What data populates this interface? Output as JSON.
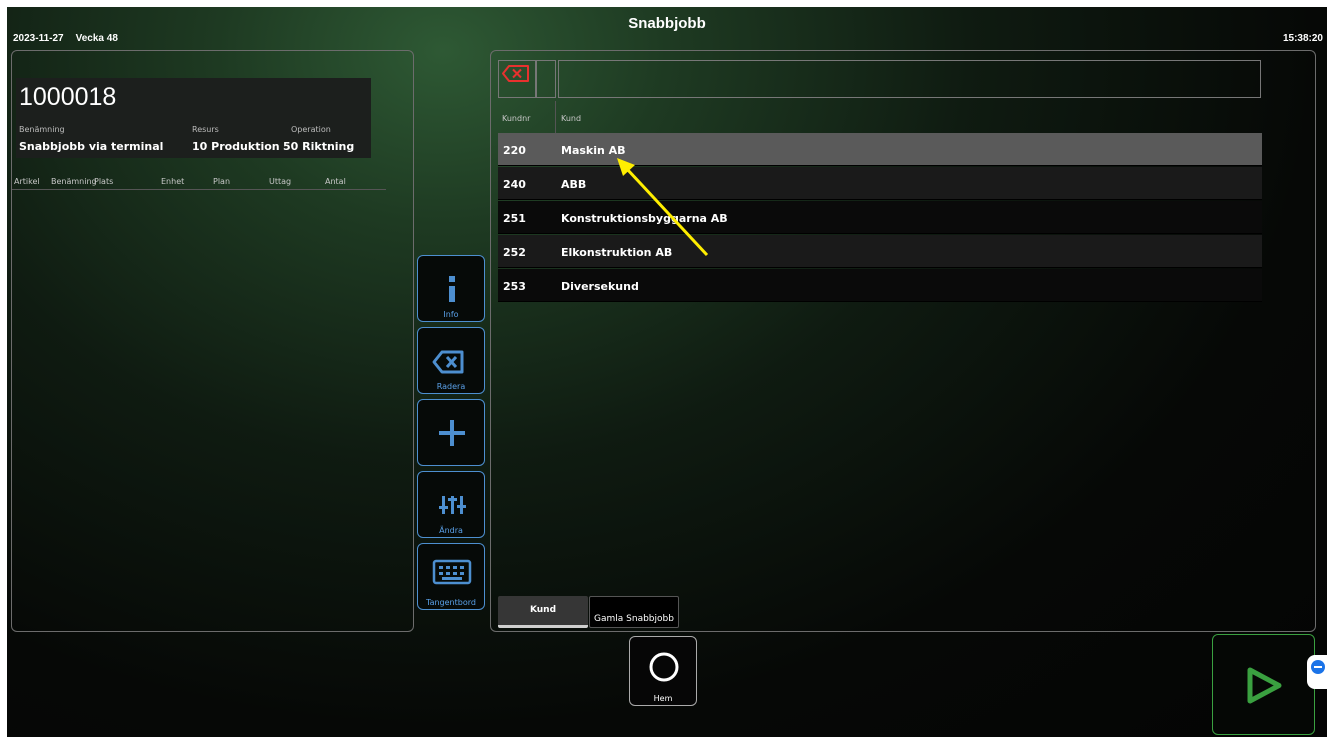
{
  "header": {
    "date": "2023-11-27",
    "week": "Vecka 48",
    "title": "Snabbjobb",
    "clock": "15:38:20"
  },
  "order": {
    "number": "1000018",
    "labels": {
      "benamning": "Benämning",
      "resurs": "Resurs",
      "operation": "Operation"
    },
    "values": {
      "benamning": "Snabbjobb via terminal",
      "resurs": "10 Produktion",
      "operation": "50 Riktning"
    }
  },
  "materials": {
    "columns": [
      "Artikel",
      "Benämning",
      "Plats",
      "Enhet",
      "Plan",
      "Uttag",
      "Antal"
    ]
  },
  "side_buttons": {
    "info": "Info",
    "radera": "Radera",
    "andra": "Ändra",
    "tangentbord": "Tangentbord"
  },
  "search": {
    "value": "",
    "placeholder": ""
  },
  "customer_table": {
    "columns": {
      "nr": "Kundnr",
      "name": "Kund"
    },
    "rows": [
      {
        "nr": "220",
        "name": "Maskin AB"
      },
      {
        "nr": "240",
        "name": "ABB"
      },
      {
        "nr": "251",
        "name": "Konstruktionsbyggarna AB"
      },
      {
        "nr": "252",
        "name": "Elkonstruktion AB"
      },
      {
        "nr": "253",
        "name": "Diversekund"
      }
    ],
    "selected_row": 0
  },
  "tabs": {
    "kund": "Kund",
    "gamla": "Gamla Snabbjobb"
  },
  "bottom": {
    "home": "Hem"
  },
  "colors": {
    "accent_blue": "#4d8fd0",
    "clear_red": "#e8312e",
    "next_green": "#3aa040",
    "arrow_yellow": "#ffee00",
    "selected_row": "#5a5a5a"
  }
}
